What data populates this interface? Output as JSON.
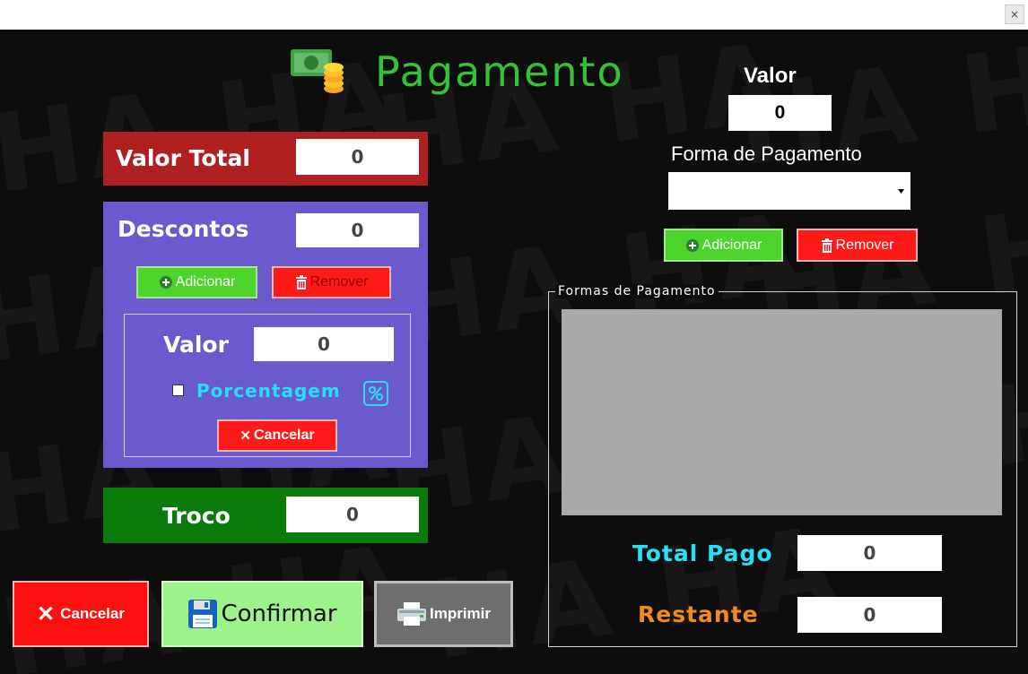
{
  "window": {
    "close_glyph": "×"
  },
  "watermark": {
    "text": "HA HA"
  },
  "header": {
    "title": "Pagamento",
    "icon": "money-coins-icon"
  },
  "valor_total": {
    "label": "Valor Total",
    "value": "0",
    "color": "#b02020"
  },
  "descontos": {
    "label": "Descontos",
    "value": "0",
    "color": "#6a5acd",
    "add_label": "Adicionar",
    "remove_label": "Remover",
    "valor_label": "Valor",
    "valor_value": "0",
    "percent_label": "Porcentagem",
    "percent_checked": false,
    "cancel_label": "Cancelar"
  },
  "troco": {
    "label": "Troco",
    "value": "0",
    "color": "#0a7a0a"
  },
  "actions": {
    "cancel_label": "Cancelar",
    "confirm_label": "Confirmar",
    "print_label": "Imprimir"
  },
  "payment": {
    "valor_label": "Valor",
    "valor_value": "0",
    "forma_label": "Forma de Pagamento",
    "forma_value": "",
    "add_label": "Adicionar",
    "remove_label": "Remover"
  },
  "formas": {
    "group_label": "Formas de Pagamento",
    "total_pago_label": "Total Pago",
    "total_pago_value": "0",
    "restante_label": "Restante",
    "restante_value": "0"
  }
}
